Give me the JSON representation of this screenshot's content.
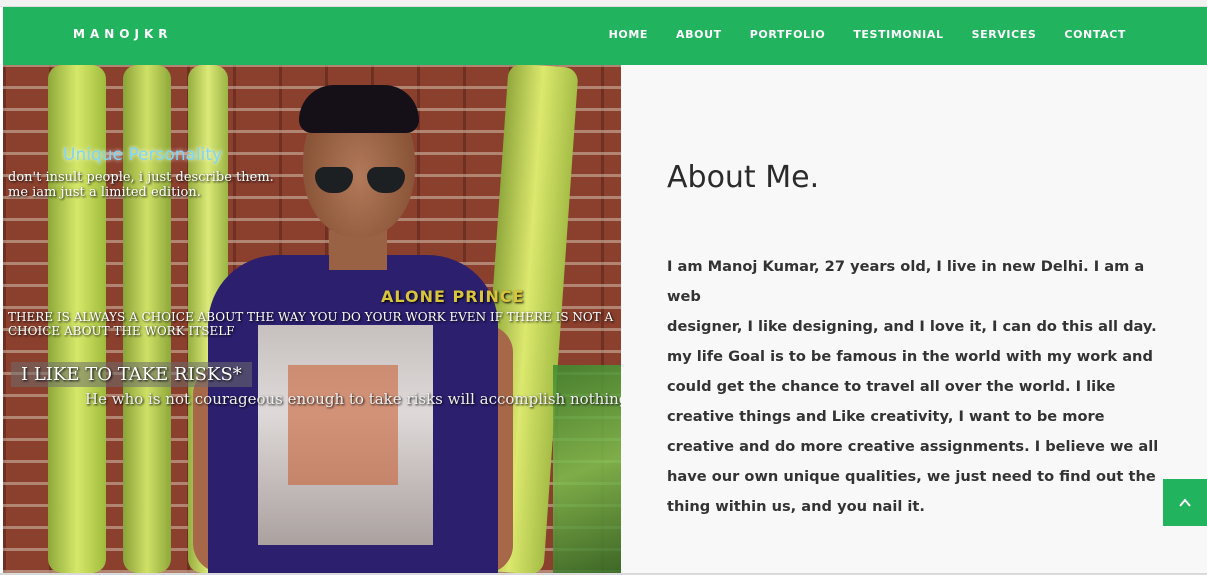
{
  "brand": "MANOJKR",
  "nav": {
    "items": [
      "HOME",
      "ABOUT",
      "PORTFOLIO",
      "TESTIMONIAL",
      "SERVICES",
      "CONTACT"
    ]
  },
  "photo_text": {
    "unique": "Unique Personality",
    "line1": "don't insult people, i just describe them.",
    "line2": "me iam just a limited edition.",
    "alone": "ALONE PRINCE",
    "choice1": "THERE IS ALWAYS A CHOICE ABOUT THE WAY YOU DO YOUR WORK EVEN IF THERE IS NOT A",
    "choice2": "CHOICE ABOUT THE WORK ITSELF",
    "risk": "I LIKE TO TAKE RISKS*",
    "courage": "He who is not courageous enough to take risks will accomplish nothing in"
  },
  "about": {
    "title": "About Me.",
    "body": "I am Manoj Kumar, 27 years old, I live in new Delhi. I am a web\ndesigner, I like designing, and I love it, I can do this all day.\nmy life Goal is to be famous in the world with my work and\ncould get the chance to travel all over the world. I like\ncreative things and Like creativity, I want to be more\ncreative and do more creative assignments. I believe we all\nhave our own unique qualities, we just need to find out the\nthing within us, and you nail it."
  },
  "colors": {
    "accent": "#21b35e",
    "heading": "#2b2b2b",
    "text": "#333333",
    "panel_bg": "#f8f8f8"
  },
  "icons": {
    "back_to_top": "chevron-up-icon"
  }
}
